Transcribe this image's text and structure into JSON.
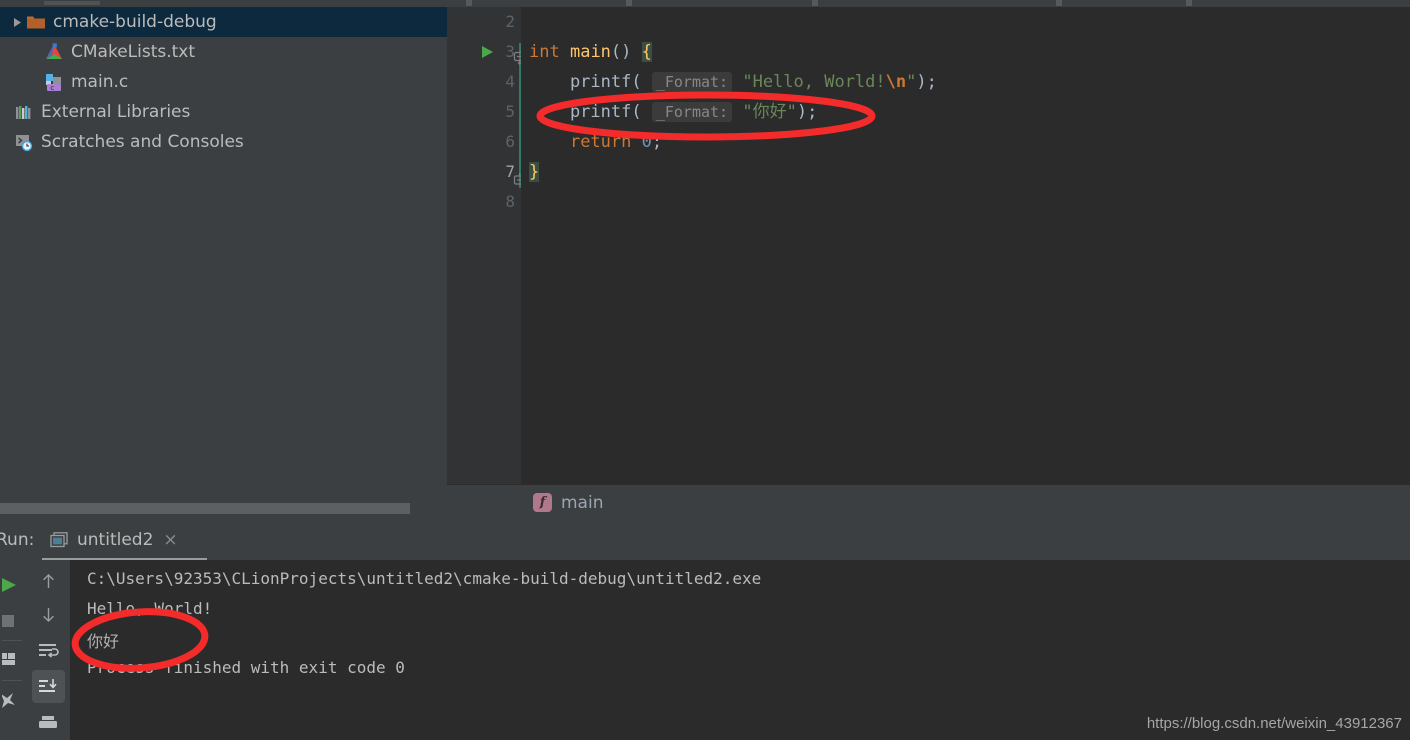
{
  "app": {
    "theme_bg": "#3c3f41",
    "editor_bg": "#2b2b2b",
    "selection_bg": "#0d293e",
    "accent_red": "#f42b2b"
  },
  "project_tree": {
    "items": [
      {
        "label": "cmake-build-debug",
        "icon": "folder-icon",
        "indent": 1,
        "selected": true,
        "arrow": "collapsed"
      },
      {
        "label": "CMakeLists.txt",
        "icon": "cmake-file-icon",
        "indent": 2,
        "selected": false,
        "arrow": "none"
      },
      {
        "label": "main.c",
        "icon": "c-file-icon",
        "indent": 2,
        "selected": false,
        "arrow": "none"
      },
      {
        "label": "External Libraries",
        "icon": "libraries-icon",
        "indent": 0,
        "selected": false,
        "arrow": "none"
      },
      {
        "label": "Scratches and Consoles",
        "icon": "scratches-icon",
        "indent": 0,
        "selected": false,
        "arrow": "none"
      }
    ]
  },
  "editor": {
    "gutter_lines": [
      "2",
      "3",
      "4",
      "5",
      "6",
      "7",
      "8"
    ],
    "current_line": "7",
    "run_marker_line": "3",
    "lines": [
      {
        "number": "2",
        "tokens": []
      },
      {
        "number": "3",
        "tokens": [
          {
            "text": "int",
            "kind": "keyword"
          },
          {
            "text": " ",
            "kind": "plain"
          },
          {
            "text": "main",
            "kind": "function"
          },
          {
            "text": "() ",
            "kind": "punct"
          },
          {
            "text": "{",
            "kind": "brace-matched"
          }
        ]
      },
      {
        "number": "4",
        "tokens": [
          {
            "text": "    printf(",
            "kind": "plain"
          },
          {
            "text": " ",
            "kind": "plain"
          },
          {
            "text": "_Format:",
            "kind": "inlay-hint"
          },
          {
            "text": " ",
            "kind": "plain"
          },
          {
            "text": "\"Hello, World!",
            "kind": "string"
          },
          {
            "text": "\\n",
            "kind": "escape"
          },
          {
            "text": "\"",
            "kind": "string"
          },
          {
            "text": ");",
            "kind": "punct"
          }
        ]
      },
      {
        "number": "5",
        "tokens": [
          {
            "text": "    printf(",
            "kind": "plain"
          },
          {
            "text": " ",
            "kind": "plain"
          },
          {
            "text": "_Format:",
            "kind": "inlay-hint"
          },
          {
            "text": " ",
            "kind": "plain"
          },
          {
            "text": "\"你好\"",
            "kind": "string"
          },
          {
            "text": ");",
            "kind": "punct"
          }
        ]
      },
      {
        "number": "6",
        "tokens": [
          {
            "text": "    ",
            "kind": "plain"
          },
          {
            "text": "return",
            "kind": "keyword"
          },
          {
            "text": " ",
            "kind": "plain"
          },
          {
            "text": "0",
            "kind": "number"
          },
          {
            "text": ";",
            "kind": "punct"
          }
        ]
      },
      {
        "number": "7",
        "tokens": [
          {
            "text": "}",
            "kind": "brace-matched"
          }
        ]
      },
      {
        "number": "8",
        "tokens": []
      }
    ]
  },
  "breadcrumb": {
    "icon_letter": "f",
    "label": "main"
  },
  "run_window": {
    "title": "Run:",
    "tab_label": "untitled2",
    "tab_close": "×",
    "console_lines": [
      "C:\\Users\\92353\\CLionProjects\\untitled2\\cmake-build-debug\\untitled2.exe",
      "Hello, World!",
      "你好",
      "Process finished with exit code 0"
    ],
    "controls": [
      {
        "name": "rerun-button",
        "icon": "play-icon"
      },
      {
        "name": "stop-button",
        "icon": "stop-icon"
      },
      {
        "name": "layout-button",
        "icon": "layout-icon"
      },
      {
        "name": "pin-button",
        "icon": "pin-icon"
      }
    ],
    "console_toolbar": [
      {
        "name": "scroll-up-button",
        "icon": "arrow-up-icon"
      },
      {
        "name": "scroll-down-button",
        "icon": "arrow-down-icon"
      },
      {
        "name": "soft-wrap-button",
        "icon": "soft-wrap-icon"
      },
      {
        "name": "scroll-to-end-button",
        "icon": "scroll-to-end-icon",
        "active": true
      },
      {
        "name": "print-button",
        "icon": "print-icon"
      }
    ]
  },
  "annotations": [
    {
      "name": "annotation-ellipse-code",
      "target": "printf-chinese-line"
    },
    {
      "name": "annotation-ellipse-console",
      "target": "console-chinese-output"
    }
  ],
  "watermark": {
    "text": "https://blog.csdn.net/weixin_43912367"
  }
}
